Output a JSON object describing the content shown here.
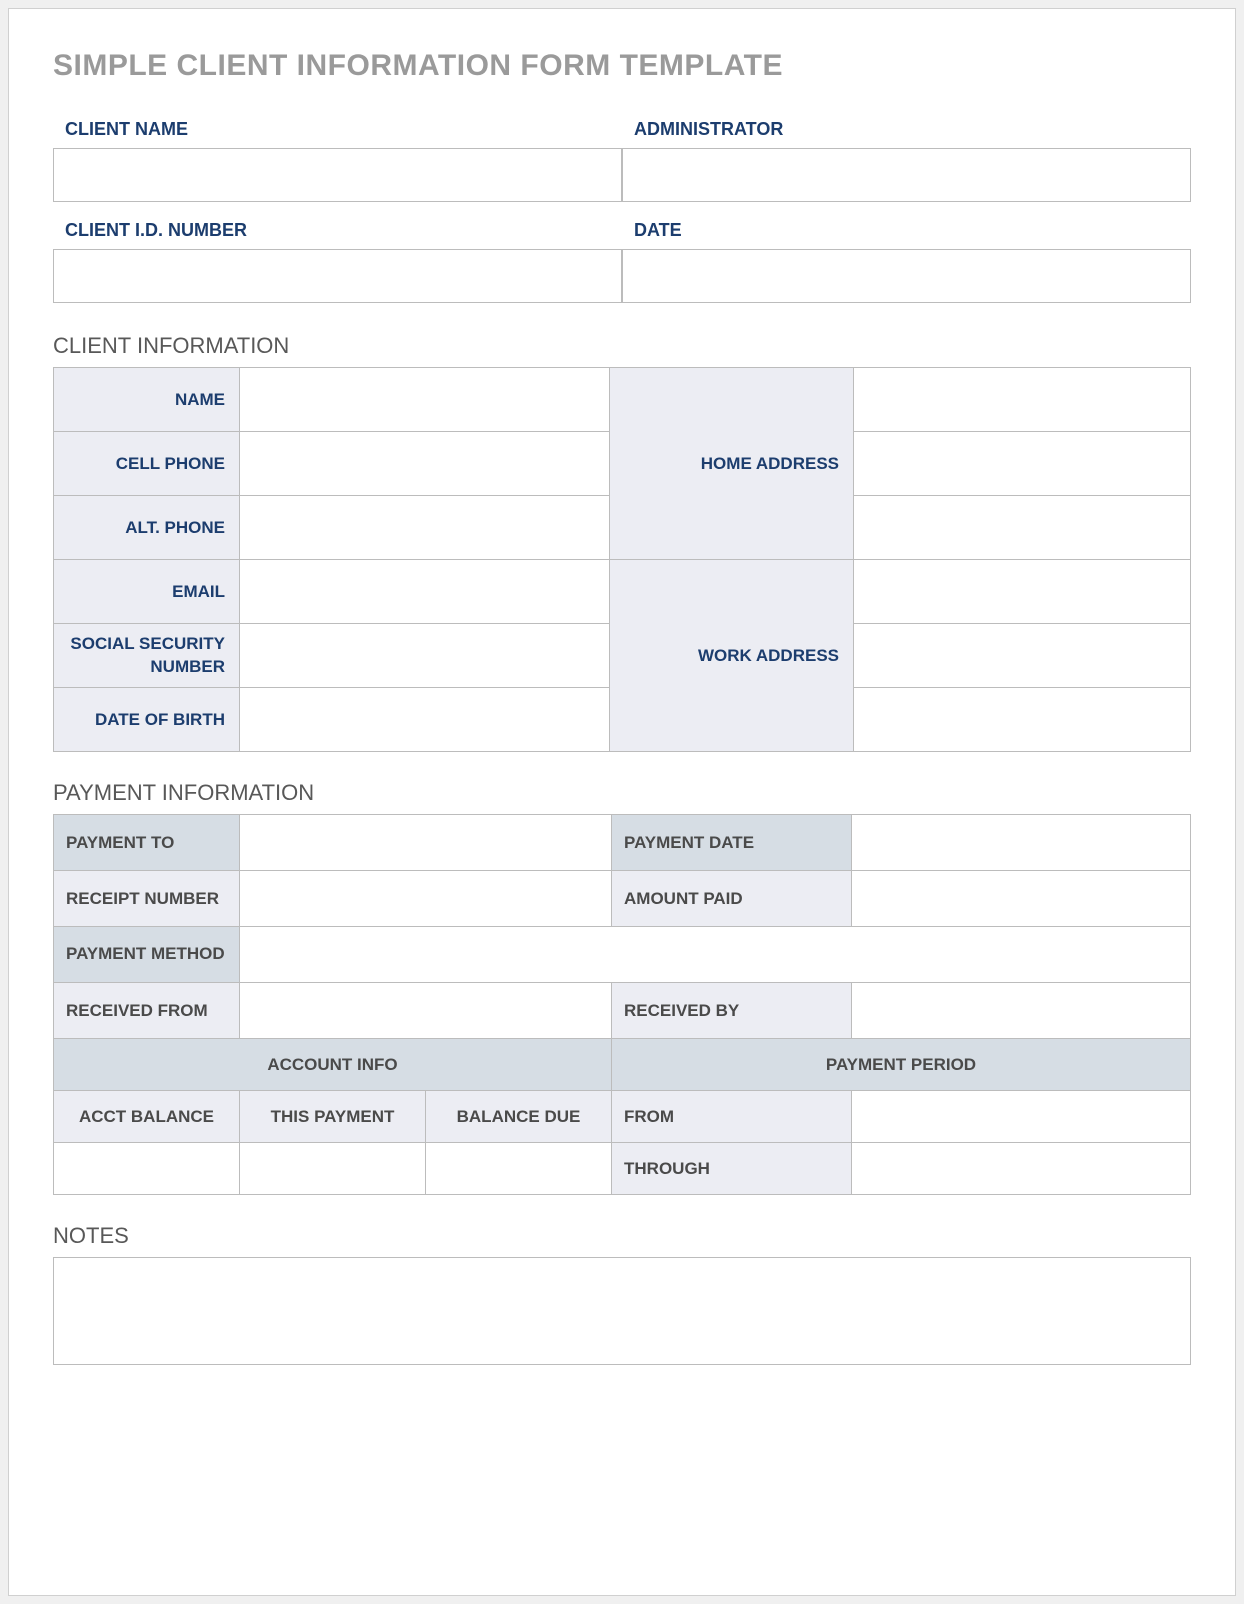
{
  "title": "SIMPLE CLIENT INFORMATION FORM TEMPLATE",
  "header": {
    "client_name_label": "CLIENT NAME",
    "client_name_value": "",
    "administrator_label": "ADMINISTRATOR",
    "administrator_value": "",
    "client_id_label": "CLIENT I.D. NUMBER",
    "client_id_value": "",
    "date_label": "DATE",
    "date_value": ""
  },
  "client_info": {
    "section_title": "CLIENT INFORMATION",
    "name_label": "NAME",
    "name_value": "",
    "cell_phone_label": "CELL PHONE",
    "cell_phone_value": "",
    "alt_phone_label": "ALT. PHONE",
    "alt_phone_value": "",
    "email_label": "EMAIL",
    "email_value": "",
    "ssn_label": "SOCIAL SECURITY NUMBER",
    "ssn_value": "",
    "dob_label": "DATE OF BIRTH",
    "dob_value": "",
    "home_address_label": "HOME ADDRESS",
    "home_address_line1": "",
    "home_address_line2": "",
    "home_address_line3": "",
    "work_address_label": "WORK ADDRESS",
    "work_address_line1": "",
    "work_address_line2": "",
    "work_address_line3": ""
  },
  "payment_info": {
    "section_title": "PAYMENT INFORMATION",
    "payment_to_label": "PAYMENT TO",
    "payment_to_value": "",
    "payment_date_label": "PAYMENT DATE",
    "payment_date_value": "",
    "receipt_number_label": "RECEIPT NUMBER",
    "receipt_number_value": "",
    "amount_paid_label": "AMOUNT PAID",
    "amount_paid_value": "",
    "payment_method_label": "PAYMENT METHOD",
    "payment_method_value": "",
    "received_from_label": "RECEIVED FROM",
    "received_from_value": "",
    "received_by_label": "RECEIVED BY",
    "received_by_value": "",
    "account_info_header": "ACCOUNT INFO",
    "payment_period_header": "PAYMENT PERIOD",
    "acct_balance_label": "ACCT BALANCE",
    "acct_balance_value": "",
    "this_payment_label": "THIS PAYMENT",
    "this_payment_value": "",
    "balance_due_label": "BALANCE DUE",
    "balance_due_value": "",
    "from_label": "FROM",
    "from_value": "",
    "through_label": "THROUGH",
    "through_value": ""
  },
  "notes": {
    "section_title": "NOTES",
    "value": ""
  }
}
